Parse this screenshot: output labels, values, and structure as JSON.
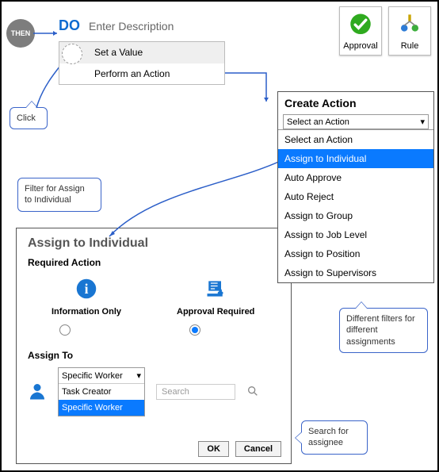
{
  "then_label": "THEN",
  "do_label": "DO",
  "do_desc": "Enter Description",
  "action_menu": {
    "set_value": "Set a Value",
    "perform_action": "Perform an Action"
  },
  "top_icons": {
    "approval": "Approval",
    "rule": "Rule"
  },
  "callouts": {
    "click": "Click",
    "filter": "Filter for Assign to Individual",
    "filters_note": "Different  filters for different assignments",
    "search_note": "Search for assignee"
  },
  "create_action": {
    "title": "Create Action",
    "placeholder": "Select an Action",
    "options": [
      "Select an Action",
      "Assign to Individual",
      "Auto Approve",
      "Auto Reject",
      "Assign to Group",
      "Assign to Job Level",
      "Assign to Position",
      "Assign to Supervisors"
    ],
    "selected_index": 1
  },
  "assign_panel": {
    "title": "Assign to Individual",
    "required_action": "Required Action",
    "info_only": "Information Only",
    "approval_required": "Approval Required",
    "selected": "approval_required",
    "assign_to": "Assign To",
    "combo": {
      "value": "Specific Worker",
      "options": [
        "Task Creator",
        "Specific Worker"
      ],
      "selected_index": 1
    },
    "search_placeholder": "Search",
    "ok": "OK",
    "cancel": "Cancel"
  }
}
